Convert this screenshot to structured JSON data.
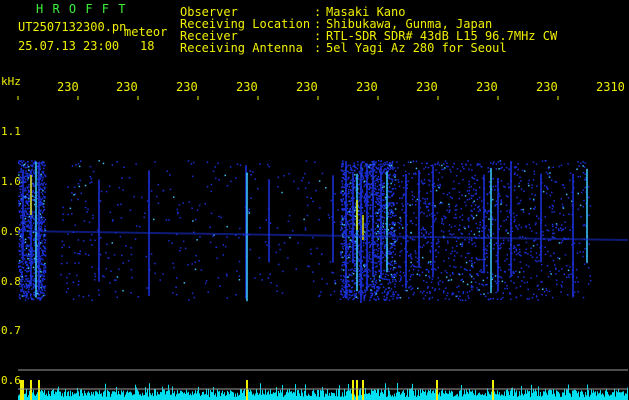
{
  "header": {
    "brand": "H R O F F T",
    "filename": "UT2507132300.pn",
    "meteor_label": "meteor",
    "datetime": "25.07.13 23:00",
    "count": "18",
    "observer_label": "Observer",
    "location_label": "Receiving Location",
    "receiver_label": "Receiver",
    "antenna_label": "Receiving Antenna",
    "colon1": ":",
    "colon2": ":",
    "colon3": ":",
    "colon4": ":",
    "observer_value": "Masaki Kano",
    "location_value": "Shibukawa, Gunma, Japan",
    "receiver_value": "RTL-SDR SDR# 43dB L15 96.7MHz CW",
    "antenna_value": "5el Yagi Az 280 for Seoul"
  },
  "axis": {
    "unit": "kHz",
    "x_ticks": [
      "230",
      "230",
      "230",
      "230",
      "230",
      "230",
      "230",
      "230",
      "230",
      "2310"
    ],
    "y_ticks": [
      "1.1",
      "1.0",
      "0.9",
      "0.8",
      "0.7",
      "0.6"
    ]
  },
  "colors": {
    "text": "#f0f000",
    "brand": "#3cf03c",
    "signal_low": "#1a2fd8",
    "signal_mid": "#3cc0f0",
    "signal_high": "#f0f000",
    "level_bars": "#00e0f0"
  }
}
